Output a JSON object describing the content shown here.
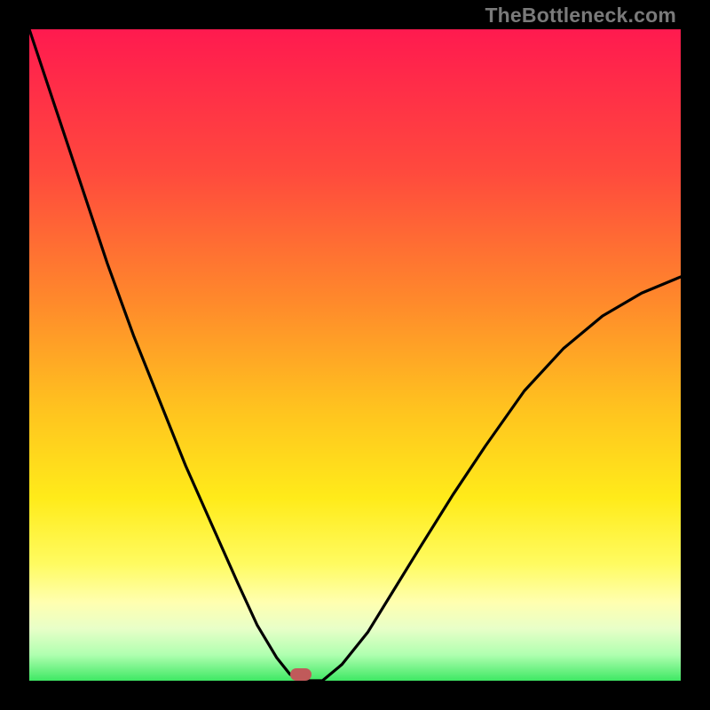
{
  "watermark": "TheBottleneck.com",
  "chart_data": {
    "type": "line",
    "title": "",
    "xlabel": "",
    "ylabel": "",
    "xlim": [
      0,
      1
    ],
    "ylim": [
      0,
      1
    ],
    "series": [
      {
        "name": "bottleneck-curve",
        "x": [
          0.0,
          0.04,
          0.08,
          0.12,
          0.16,
          0.2,
          0.24,
          0.28,
          0.32,
          0.35,
          0.38,
          0.4,
          0.417,
          0.45,
          0.48,
          0.52,
          0.56,
          0.6,
          0.65,
          0.7,
          0.76,
          0.82,
          0.88,
          0.94,
          1.0
        ],
        "y": [
          1.0,
          0.88,
          0.76,
          0.64,
          0.53,
          0.43,
          0.33,
          0.24,
          0.15,
          0.085,
          0.035,
          0.01,
          0.0,
          0.0,
          0.025,
          0.075,
          0.14,
          0.205,
          0.285,
          0.36,
          0.445,
          0.51,
          0.56,
          0.595,
          0.62
        ]
      }
    ],
    "annotations": [
      {
        "name": "bottleneck-marker",
        "x": 0.417,
        "y": 0.01
      }
    ],
    "colors": {
      "gradient_top": "#ff1a4f",
      "gradient_bottom": "#3fe864",
      "curve": "#000000",
      "marker": "#c05a5a",
      "frame": "#000000"
    }
  }
}
